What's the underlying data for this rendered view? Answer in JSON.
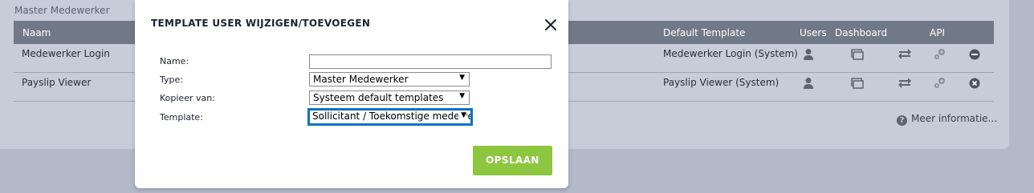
{
  "background": {
    "panel_title": "Master Medewerker",
    "columns": {
      "name": "Naam",
      "default_template": "Default Template",
      "users": "Users",
      "dashboard": "Dashboard",
      "api": "API"
    },
    "rows": [
      {
        "name": "Medewerker Login",
        "default_template": "Medewerker Login (System)",
        "action": "minus-circle-icon"
      },
      {
        "name": "Payslip Viewer",
        "default_template": "Payslip Viewer (System)",
        "action": "x-circle-icon"
      }
    ],
    "more_info": "Meer informatie..."
  },
  "modal": {
    "title": "TEMPLATE USER WIJZIGEN/TOEVOEGEN",
    "fields": {
      "name": {
        "label": "Name:",
        "value": ""
      },
      "type": {
        "label": "Type:",
        "value": "Master Medewerker"
      },
      "copy_from": {
        "label": "Kopieer van:",
        "value": "Systeem default templates"
      },
      "template": {
        "label": "Template:",
        "value": "Sollicitant / Toekomstige medewerker"
      }
    },
    "save_label": "OPSLAAN"
  },
  "colors": {
    "accent_green": "#8dc63f",
    "focus_blue": "#0d72c4",
    "table_header": "#727986"
  }
}
